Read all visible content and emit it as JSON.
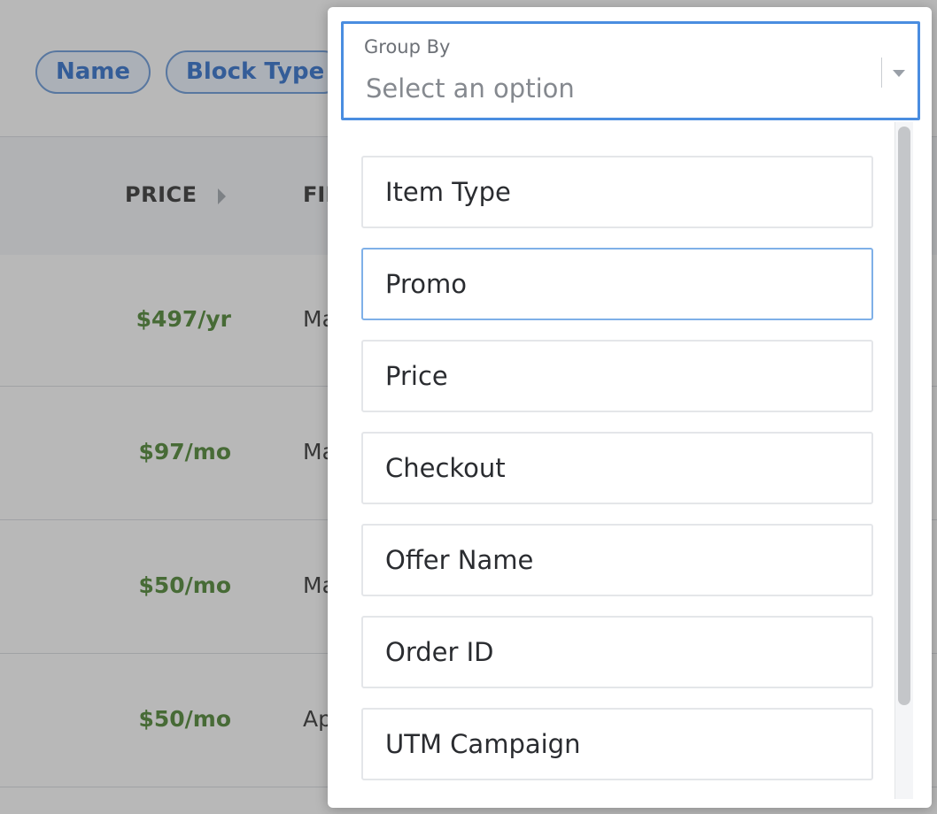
{
  "filter_chips": [
    "Name",
    "Block Type"
  ],
  "table": {
    "headers": {
      "price": "PRICE",
      "first": "FIRS"
    },
    "rows": [
      {
        "price": "$497/yr",
        "date": "May"
      },
      {
        "price": "$97/mo",
        "date": "May"
      },
      {
        "price": "$50/mo",
        "date": "May"
      },
      {
        "price": "$50/mo",
        "date": "Apr"
      }
    ]
  },
  "group_by": {
    "label": "Group By",
    "placeholder": "Select an option",
    "options": [
      "Item Type",
      "Promo",
      "Price",
      "Checkout",
      "Offer Name",
      "Order ID",
      "UTM Campaign"
    ],
    "hovered_option": "Promo"
  },
  "colors": {
    "accent": "#4a8de0",
    "price_green": "#3d7a1f",
    "chip_text": "#1d62c8"
  },
  "icons": [
    "sort-caret-icon",
    "dropdown-caret-icon"
  ]
}
